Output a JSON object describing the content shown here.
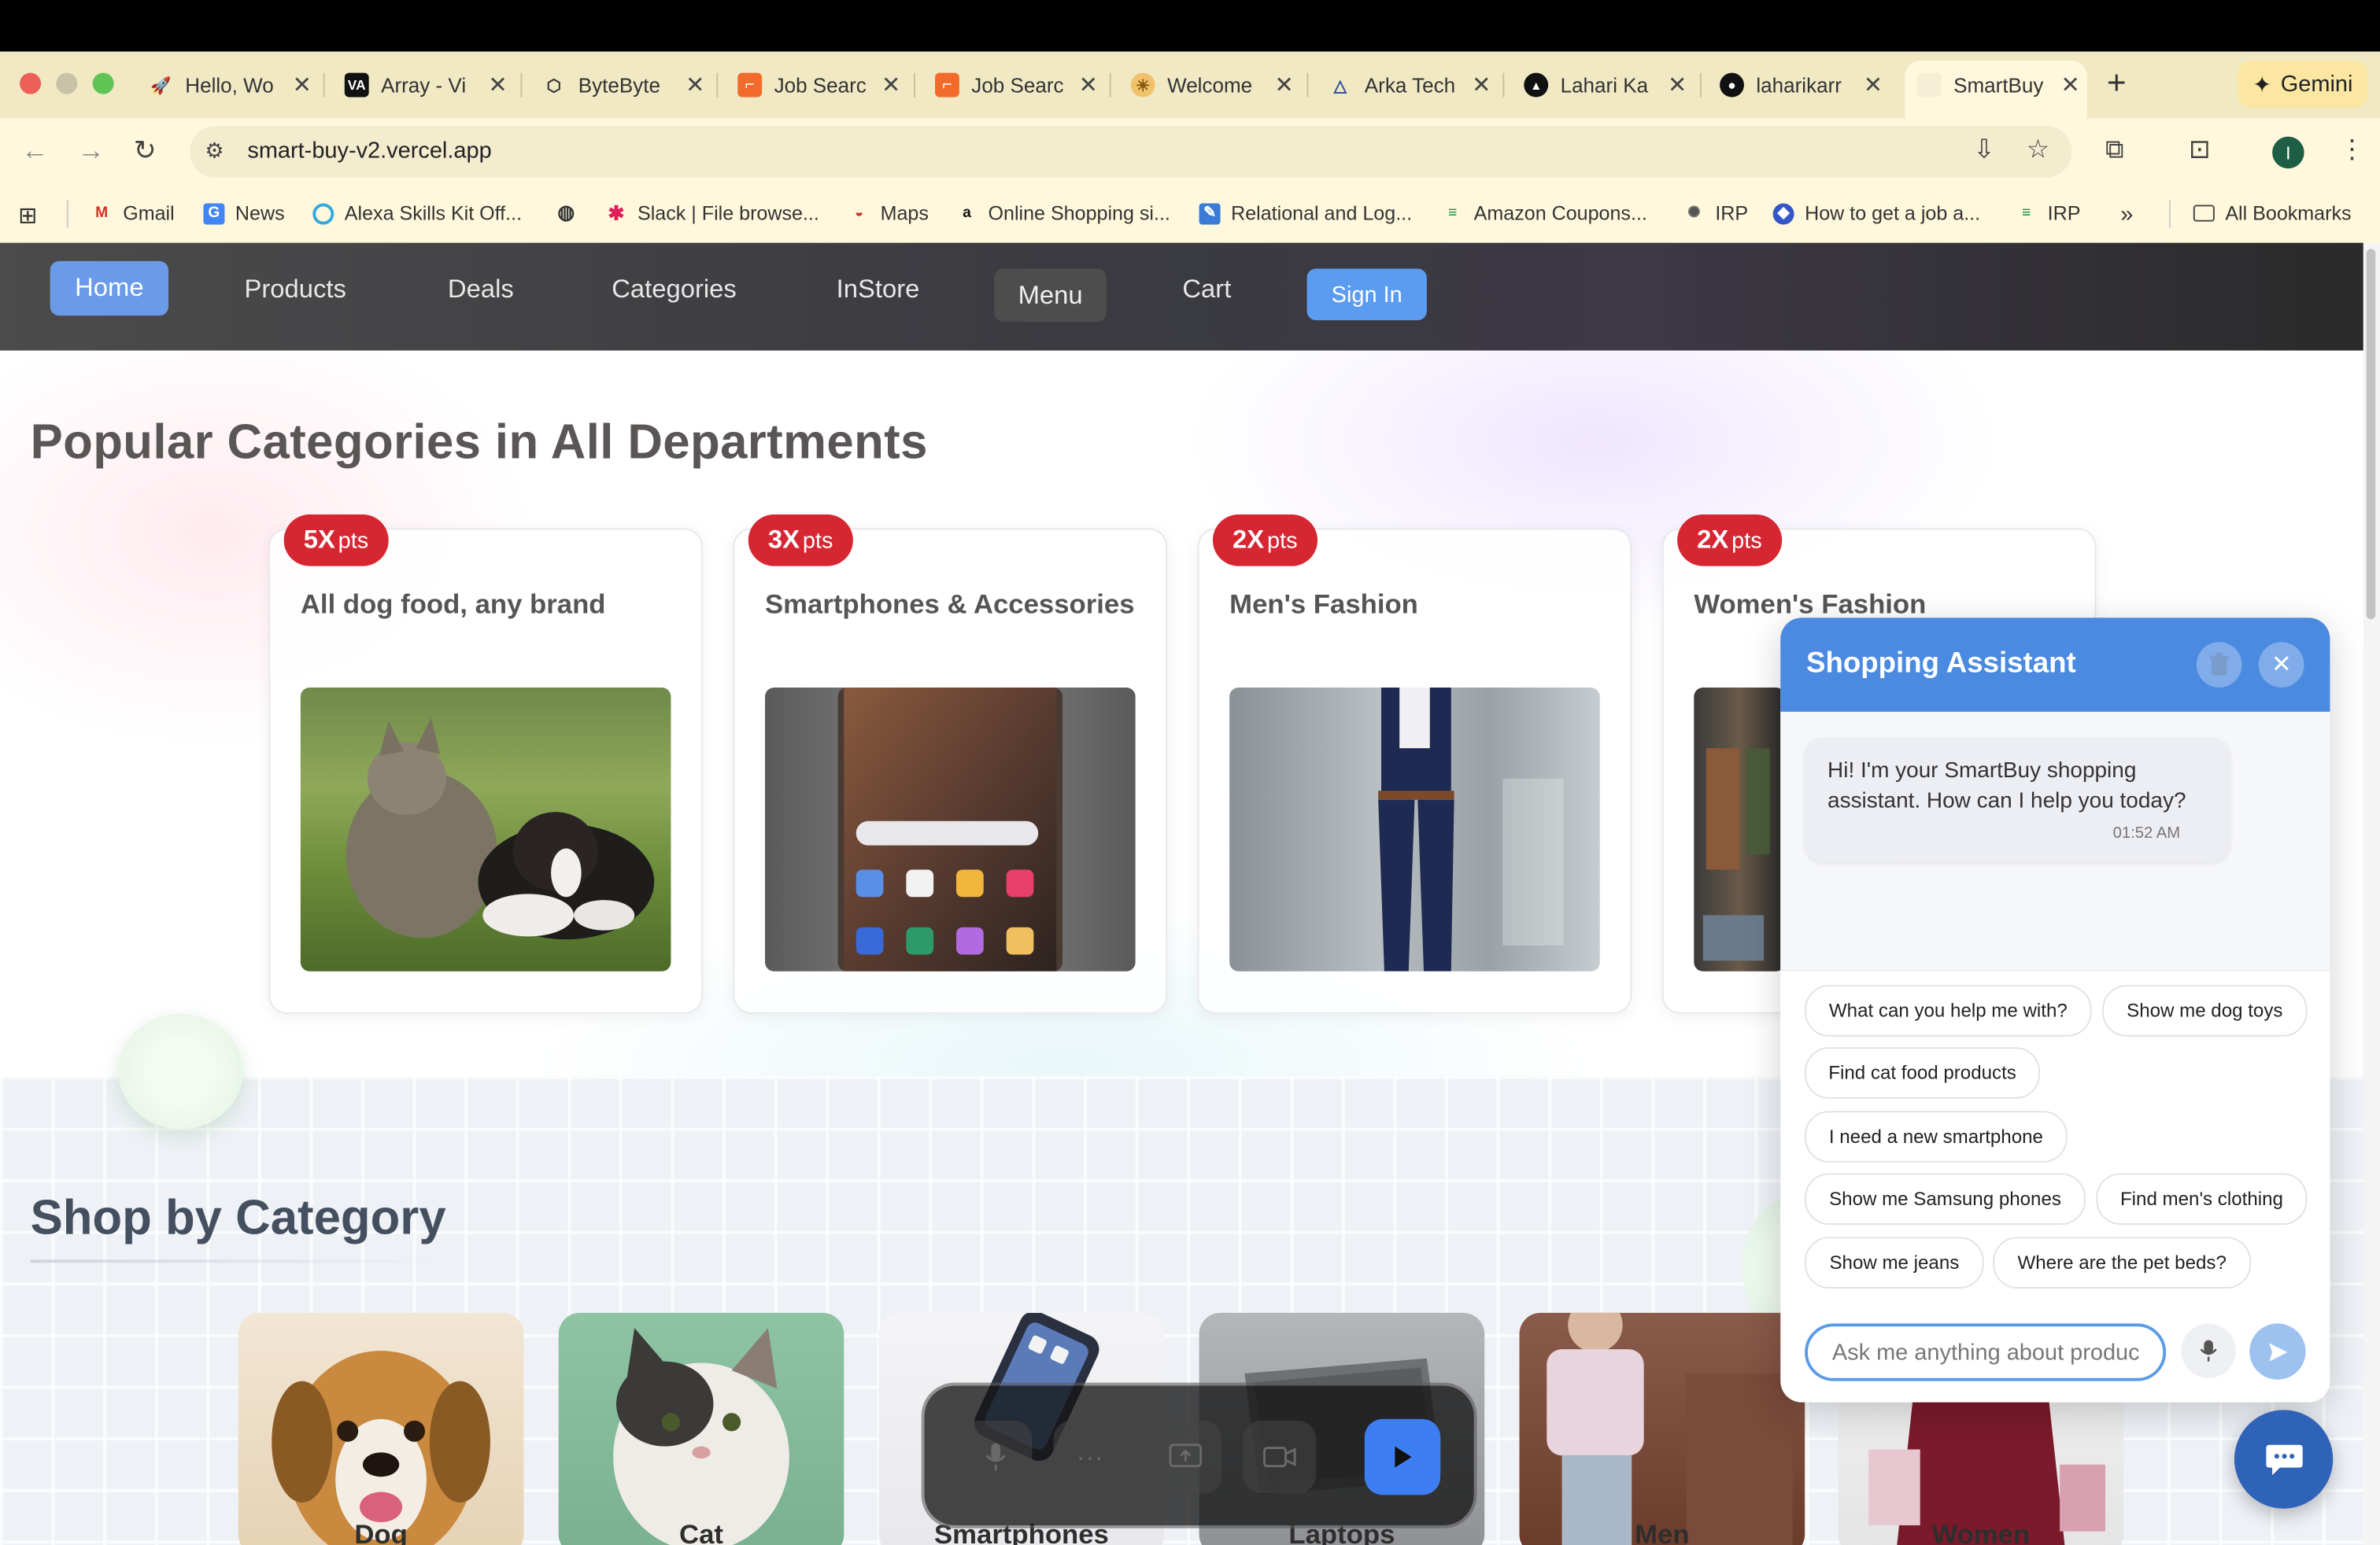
{
  "browser": {
    "tabs": [
      {
        "title": "Hello, Wo",
        "icon": "rocket-icon"
      },
      {
        "title": "Array - Vi",
        "icon": "va-logo-icon"
      },
      {
        "title": "ByteByte",
        "icon": "bytebyte-icon"
      },
      {
        "title": "Job Searc",
        "icon": "job-search-icon"
      },
      {
        "title": "Job Searc",
        "icon": "job-search-icon"
      },
      {
        "title": "Welcome",
        "icon": "sun-icon"
      },
      {
        "title": "Arka Tech",
        "icon": "arka-icon"
      },
      {
        "title": "Lahari Ka",
        "icon": "lahari-icon"
      },
      {
        "title": "laharikarr",
        "icon": "github-icon"
      },
      {
        "title": "SmartBuy",
        "icon": "smartbuy-icon",
        "active": true
      }
    ],
    "gemini_label": "Gemini",
    "url": "smart-buy-v2.vercel.app",
    "profile_initial": "I",
    "bookmarks": [
      {
        "label": "Gmail"
      },
      {
        "label": "News"
      },
      {
        "label": "Alexa Skills Kit Off..."
      },
      {
        "label": ""
      },
      {
        "label": "Slack | File browse..."
      },
      {
        "label": "Maps"
      },
      {
        "label": "Online Shopping si..."
      },
      {
        "label": "Relational and Log..."
      },
      {
        "label": "Amazon Coupons..."
      },
      {
        "label": "IRP"
      },
      {
        "label": "How to get a job a..."
      },
      {
        "label": "IRP"
      }
    ],
    "more_bookmarks": "»",
    "all_bookmarks": "All Bookmarks"
  },
  "site": {
    "nav": {
      "home": "Home",
      "products": "Products",
      "deals": "Deals",
      "categories": "Categories",
      "instore": "InStore",
      "menu": "Menu",
      "cart": "Cart",
      "signin": "Sign In"
    },
    "popular": {
      "title": "Popular Categories in All Departments",
      "pts_label": "pts",
      "cards": [
        {
          "multiplier": "5X",
          "name": "All dog food, any brand"
        },
        {
          "multiplier": "3X",
          "name": "Smartphones & Accessories"
        },
        {
          "multiplier": "2X",
          "name": "Men's Fashion"
        },
        {
          "multiplier": "2X",
          "name": "Women's Fashion"
        }
      ]
    },
    "shop": {
      "title": "Shop by Category",
      "categories": [
        "Dog",
        "Cat",
        "Smartphones",
        "Laptops",
        "Men",
        "Women"
      ]
    }
  },
  "chat": {
    "title": "Shopping Assistant",
    "greeting": "Hi! I'm your SmartBuy shopping assistant. How can I help you today?",
    "time": "01:52 AM",
    "suggestions": [
      "What can you help me with?",
      "Show me dog toys",
      "Find cat food products",
      "I need a new smartphone",
      "Show me Samsung phones",
      "Find men's clothing",
      "Show me jeans",
      "Where are the pet beds?"
    ],
    "input_placeholder": "Ask me anything about products..."
  },
  "colors": {
    "accent_blue": "#4a8ae0",
    "badge_red": "#d62631",
    "nav_home": "#6a9ae8"
  }
}
